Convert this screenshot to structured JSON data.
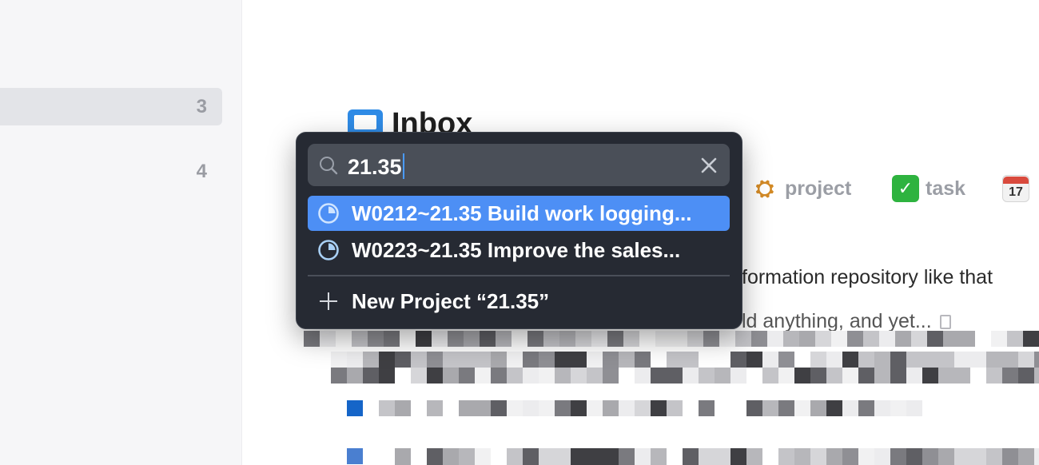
{
  "sidebar": {
    "rows": [
      {
        "count": "3",
        "selected": true
      },
      {
        "count": "4",
        "selected": false
      }
    ]
  },
  "main": {
    "title": "Inbox",
    "tags": [
      {
        "label": "project",
        "icon": "construction-crane-icon"
      },
      {
        "label": "task",
        "icon": "checkmark-icon"
      },
      {
        "label": "",
        "icon": "calendar-icon",
        "calendar_month": "JUL",
        "calendar_day": "17"
      }
    ],
    "text_line_1": "formation repository like that",
    "text_line_2": "ld anything, and yet..."
  },
  "popup": {
    "search_value": "21.35",
    "results": [
      {
        "label": "W0212~21.35 Build work logging...",
        "active": true
      },
      {
        "label": "W0223~21.35 Improve the sales...",
        "active": false
      }
    ],
    "new_project_label": "New Project “21.35”"
  },
  "colors": {
    "accent": "#4d8ff5",
    "popup_bg": "#262a33",
    "search_bg": "#4a4f58",
    "project_icon": "#a9d0f5"
  }
}
